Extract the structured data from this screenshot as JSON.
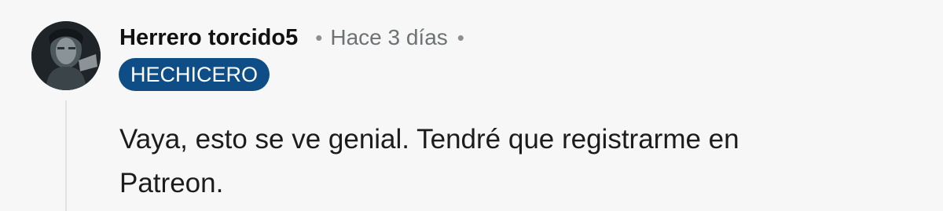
{
  "comment": {
    "author": "Herrero torcido5",
    "timestamp": "Hace 3 días",
    "separator": "•",
    "flair": "HECHICERO",
    "body": "Vaya, esto se ve genial. Tendré que registrarme en Patreon."
  },
  "colors": {
    "flair_background": "#0e4d86",
    "flair_text": "#ffffff",
    "username": "#111111",
    "timestamp": "#6d7275",
    "body_text": "#1c1c1c",
    "thread_line": "#e1e3e5"
  },
  "icons": {
    "more": "separator-dot"
  }
}
